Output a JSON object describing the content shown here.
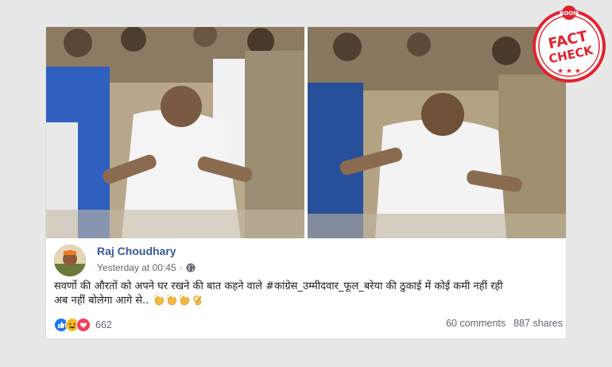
{
  "post": {
    "author": "Raj Choudhary",
    "timestamp": "Yesterday at 00:45",
    "privacy_icon": "globe-icon",
    "text_line1": "सवर्णो की औरतों को अपने घर रखने की बात कहने वाले #कांग्रेस_उम्मीदवार_फूल_बरेया की ठुकाई में कोई कमी नहीं रही",
    "text_line2": "अब नहीं बोलेगा आगे से..",
    "emojis": [
      "clapping-hands-icon",
      "clapping-hands-icon",
      "clapping-hands-icon",
      "ok-hand-icon"
    ]
  },
  "engagement": {
    "reaction_icons": [
      "like-icon",
      "haha-icon",
      "love-icon"
    ],
    "reaction_count": "662",
    "comments": "60 comments",
    "shares": "887 shares"
  },
  "stamp": {
    "brand": "BOOM",
    "line1": "FACT",
    "line2": "CHECK",
    "color": "#e0232f"
  },
  "colors": {
    "author_link": "#385898",
    "meta_text": "#606770",
    "background": "#e7e7e7"
  }
}
